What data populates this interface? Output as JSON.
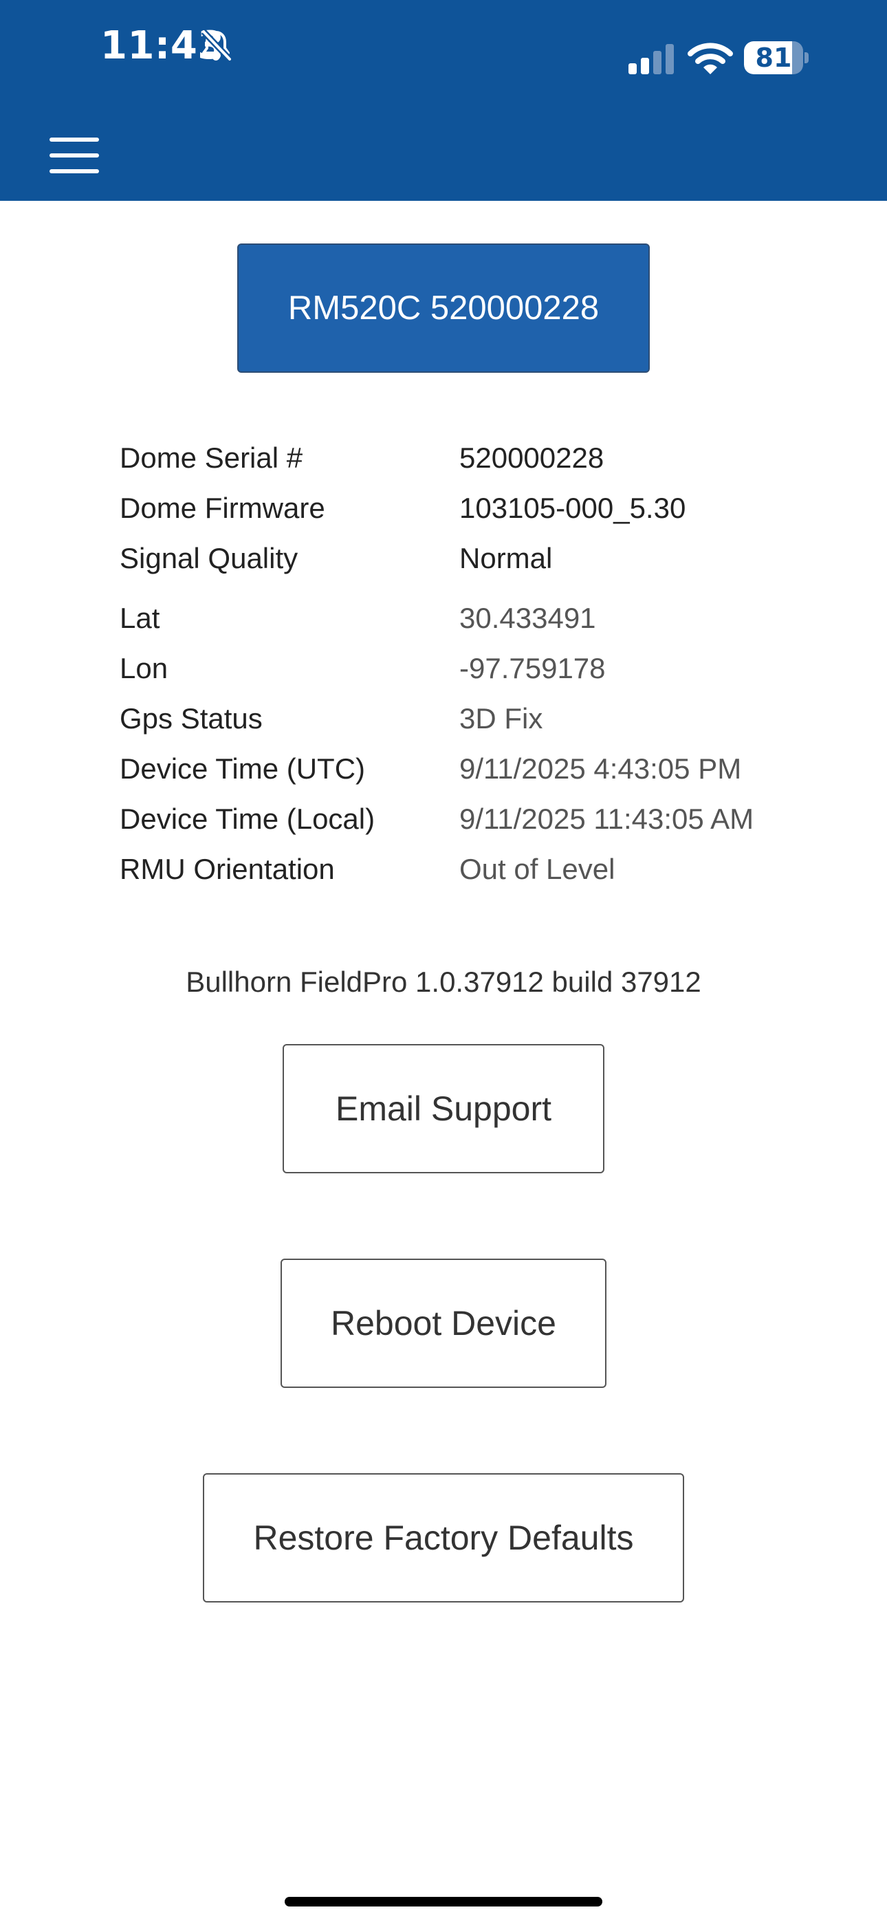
{
  "status_bar": {
    "time": "11:43",
    "battery_level": "81",
    "battery_fraction": 0.81
  },
  "icons": {
    "bell": "bell-slash-icon",
    "signal": "cellular-signal-icon",
    "wifi": "wifi-icon",
    "battery": "battery-icon",
    "menu": "hamburger-menu-icon"
  },
  "colors": {
    "header": "#0f5499",
    "device_button": "#1f62ac"
  },
  "device_button_label": "RM520C 520000228",
  "info": [
    {
      "label": "Dome Serial #",
      "value": "520000228"
    },
    {
      "label": "Dome Firmware",
      "value": "103105-000_5.30"
    },
    {
      "label": "Signal Quality",
      "value": "Normal"
    },
    {
      "label": "Lat",
      "value": "30.433491"
    },
    {
      "label": "Lon",
      "value": "-97.759178"
    },
    {
      "label": "Gps Status",
      "value": "3D Fix"
    },
    {
      "label": "Device Time (UTC)",
      "value": "9/11/2025 4:43:05 PM"
    },
    {
      "label": "Device Time (Local)",
      "value": "9/11/2025 11:43:05 AM"
    },
    {
      "label": "RMU Orientation",
      "value": "Out of Level"
    }
  ],
  "version_text": "Bullhorn FieldPro 1.0.37912 build 37912",
  "actions": {
    "email_support": "Email Support",
    "reboot_device": "Reboot Device",
    "restore_factory_defaults": "Restore Factory Defaults"
  }
}
